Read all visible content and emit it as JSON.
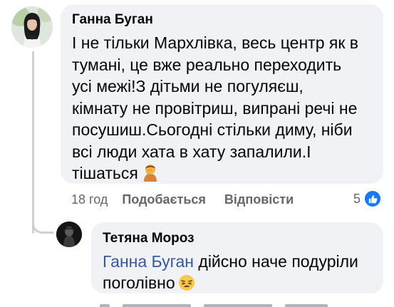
{
  "main_comment": {
    "author": "Ганна Буган",
    "lines": [
      "І не тільки Мархлівка, весь центр як в",
      "тумані, це вже реально переходить",
      "усі межі!З дітьми не погуляєш,",
      "кімнату не провітриш, випрані речі не",
      "посушиш.Сьогодні стільки диму, ніби",
      "всі люди хата в хату запалили.І",
      "тішаться"
    ],
    "emoji": "person-facepalming-emoji",
    "time": "18 год",
    "like_label": "Подобається",
    "reply_label": "Відповісти",
    "reaction_count": "5",
    "reaction_icon": "like-icon",
    "reaction_color": "#1877f2"
  },
  "reply_comment": {
    "author": "Тетяна Мороз",
    "mention": "Ганна Буган",
    "line1_rest": " дійсно наче подуріли",
    "line2": "поголівно",
    "emoji": "tired-face-emoji"
  },
  "colors": {
    "bubble_bg": "#f0f2f5",
    "secondary_text": "#65676b",
    "mention": "#385898",
    "thread_line": "#ced0d4"
  }
}
